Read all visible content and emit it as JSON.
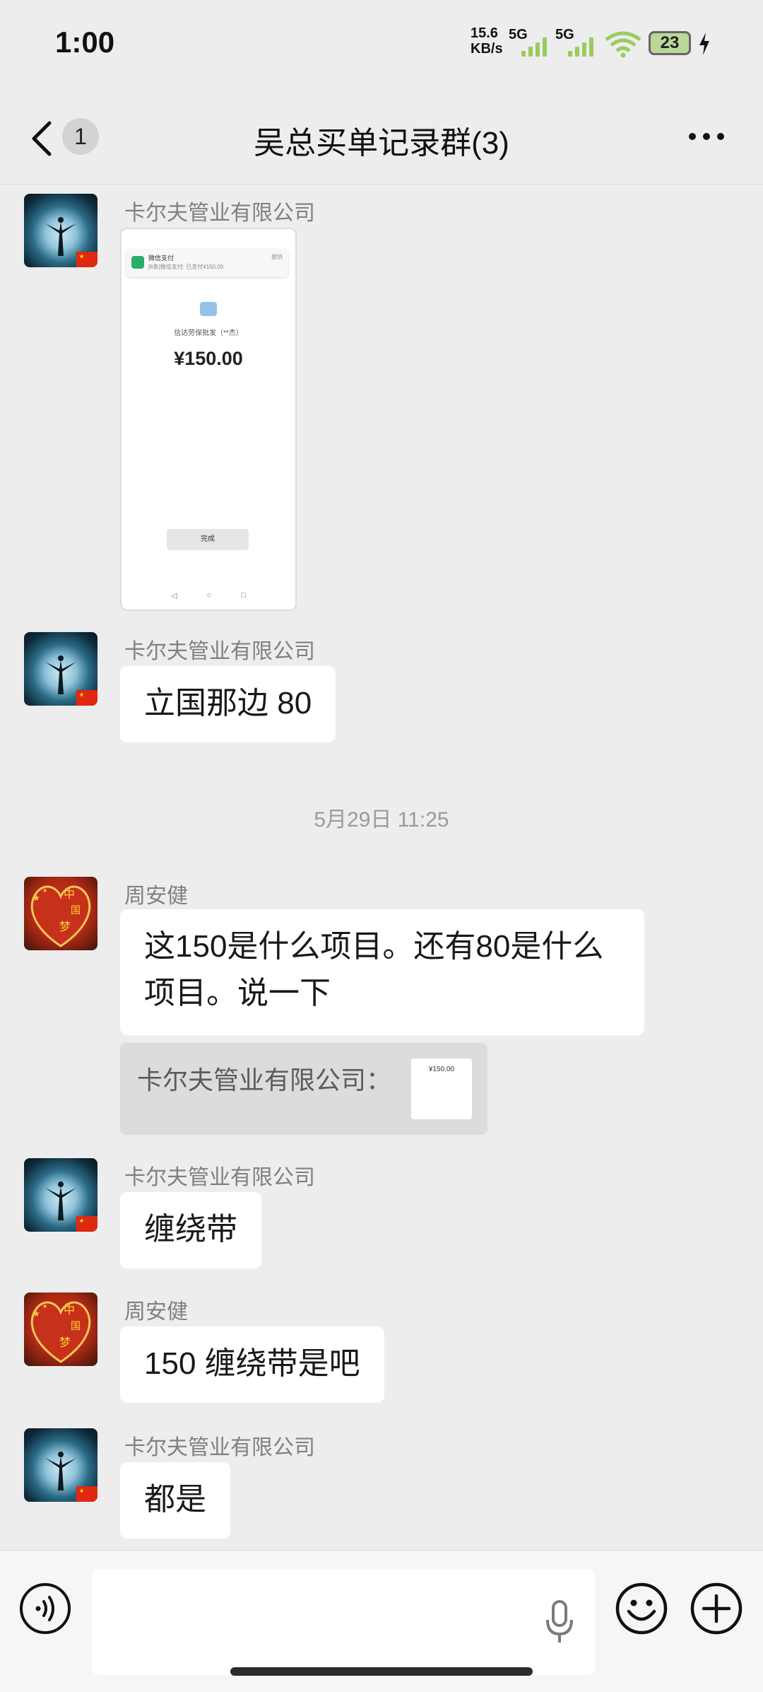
{
  "status_bar": {
    "time": "1:00",
    "net_speed": "15.6",
    "net_unit": "KB/s",
    "sim1": "5G",
    "sim2": "5G",
    "battery": "23"
  },
  "header": {
    "unread_count": "1",
    "title": "吴总买单记录群(3)"
  },
  "messages": [
    {
      "sender": "卡尔夫管业有限公司",
      "type": "image",
      "image": {
        "notification_title": "微信支付",
        "notification_body": "[6条]微信支付: 已支付¥150.00",
        "notification_action": "撤销",
        "merchant": "信达劳保批发（**杰）",
        "amount": "¥150.00",
        "done_label": "完成",
        "nav_back": "◁",
        "nav_home": "○",
        "nav_recent": "□"
      }
    },
    {
      "sender": "卡尔夫管业有限公司",
      "type": "text",
      "text": "立国那边 80"
    },
    {
      "type": "timestamp",
      "text": "5月29日 11:25"
    },
    {
      "sender": "周安健",
      "type": "text",
      "text_line1": "这150是什么项目。还有80是什么",
      "text_line2": "项目。说一下",
      "quote": {
        "label": "卡尔夫管业有限公司：",
        "thumb_text": "¥150.00"
      }
    },
    {
      "sender": "卡尔夫管业有限公司",
      "type": "text",
      "text": "缠绕带"
    },
    {
      "sender": "周安健",
      "type": "text",
      "text": "150 缠绕带是吧"
    },
    {
      "sender": "卡尔夫管业有限公司",
      "type": "text",
      "text": "都是"
    }
  ],
  "avatar_chars": [
    "中",
    "国",
    "梦"
  ],
  "input": {
    "value": ""
  },
  "icons": [
    "back-chevron-icon",
    "more-icon",
    "voice-icon",
    "mic-icon",
    "emoji-icon",
    "plus-icon"
  ],
  "colors": {
    "background": "#ededed",
    "bubble": "#ffffff",
    "wechat_green": "#2aae67"
  }
}
